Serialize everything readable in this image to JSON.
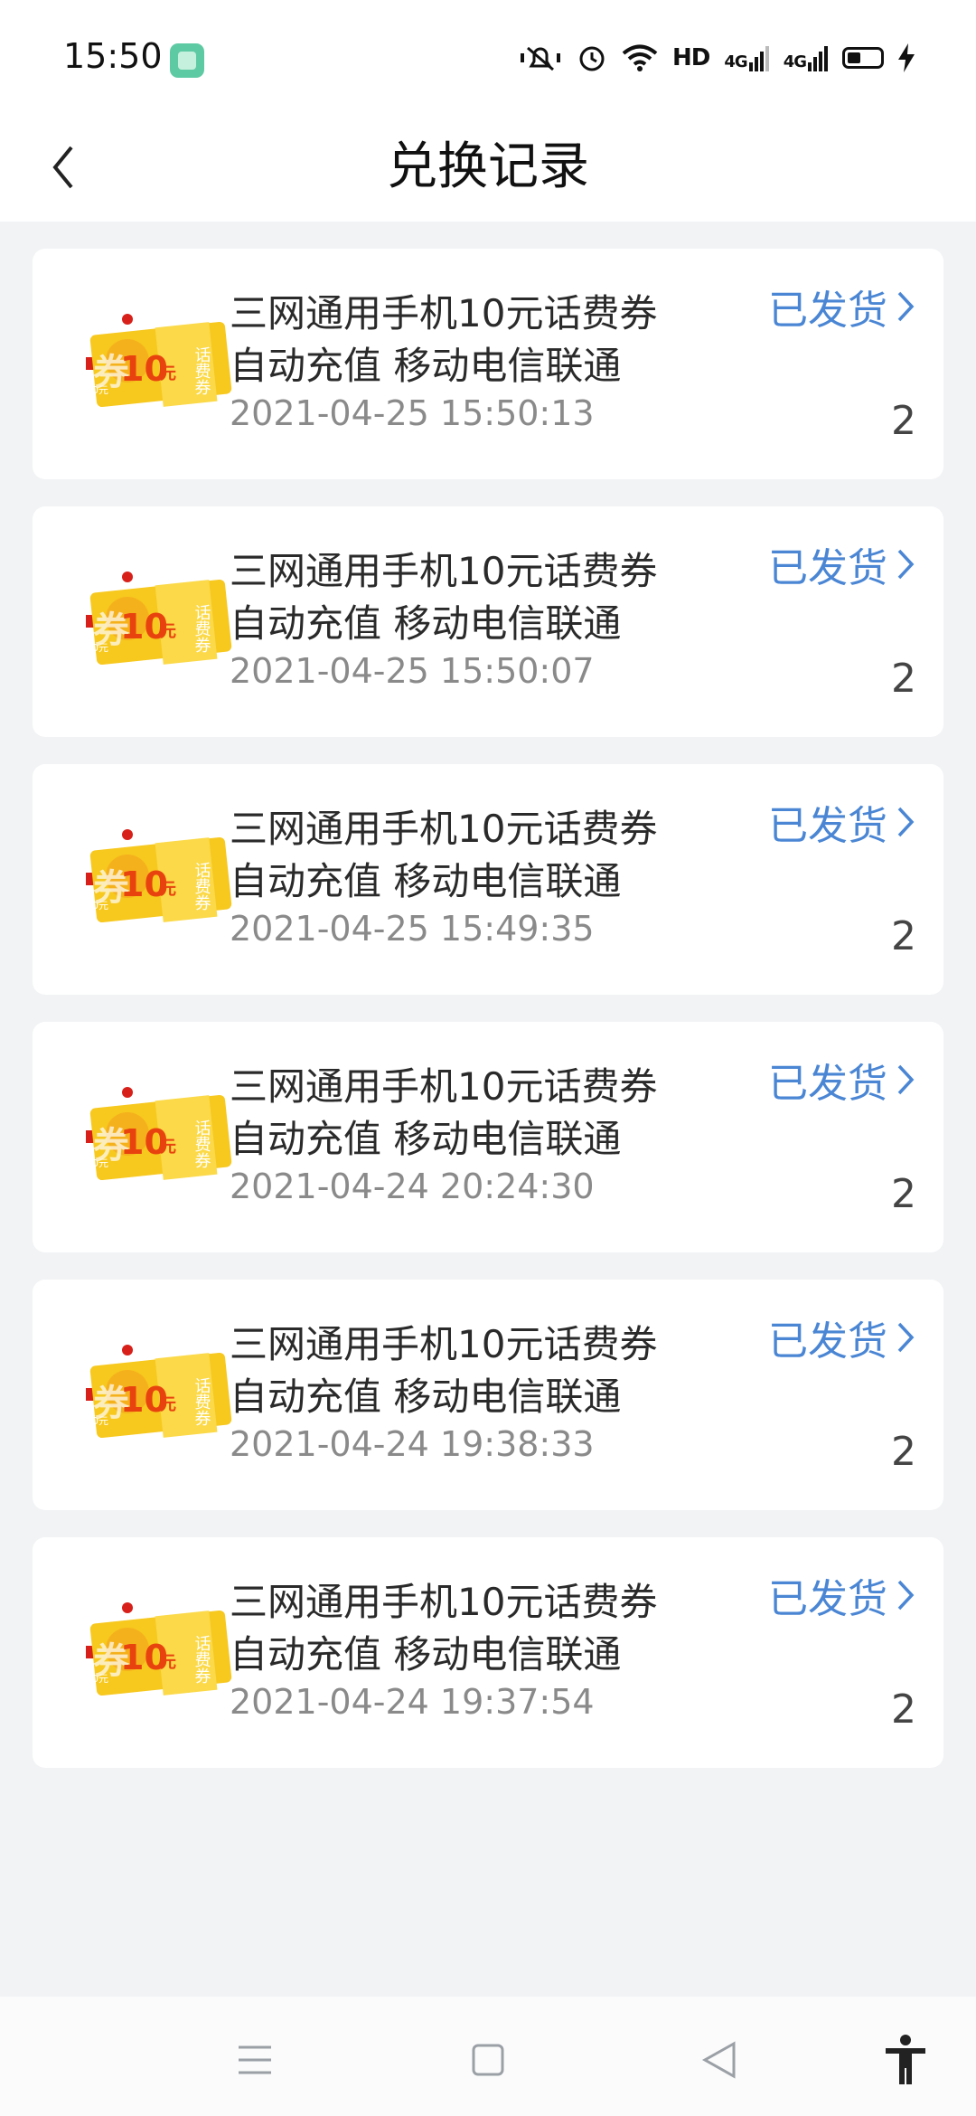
{
  "status_bar": {
    "time": "15:50",
    "hd_label": "HD",
    "signal1_label": "4G",
    "signal2_label": "4G",
    "icons": [
      "app-icon",
      "mute-icon",
      "alarm-icon",
      "wifi-icon",
      "signal-icon",
      "signal-icon",
      "battery-icon",
      "charging-icon"
    ]
  },
  "header": {
    "title": "兑换记录",
    "back_icon": "chevron-left-icon"
  },
  "records": [
    {
      "title_line1": "三网通用手机10元话费券",
      "title_line2": "自动充值 移动电信联通",
      "date": "2021-04-25 15:50:13",
      "status": "已发货",
      "quantity": "2"
    },
    {
      "title_line1": "三网通用手机10元话费券",
      "title_line2": "自动充值 移动电信联通",
      "date": "2021-04-25 15:50:07",
      "status": "已发货",
      "quantity": "2"
    },
    {
      "title_line1": "三网通用手机10元话费券",
      "title_line2": "自动充值 移动电信联通",
      "date": "2021-04-25 15:49:35",
      "status": "已发货",
      "quantity": "2"
    },
    {
      "title_line1": "三网通用手机10元话费券",
      "title_line2": "自动充值 移动电信联通",
      "date": "2021-04-24 20:24:30",
      "status": "已发货",
      "quantity": "2"
    },
    {
      "title_line1": "三网通用手机10元话费券",
      "title_line2": "自动充值 移动电信联通",
      "date": "2021-04-24 19:38:33",
      "status": "已发货",
      "quantity": "2"
    },
    {
      "title_line1": "三网通用手机10元话费券",
      "title_line2": "自动充值 移动电信联通",
      "date": "2021-04-24 19:37:54",
      "status": "已发货",
      "quantity": "2"
    }
  ],
  "coupon_image": {
    "amount": "10",
    "unit": "元",
    "side_text": "话费券",
    "big_char": "券",
    "small_tag": "10元"
  },
  "nav_bar": {
    "icons": [
      "menu-icon",
      "home-square-icon",
      "back-triangle-icon",
      "accessibility-icon"
    ]
  },
  "colors": {
    "accent_blue": "#4a86d4",
    "coupon_yellow": "#f7c81e",
    "coupon_orange": "#f39a1a",
    "background": "#f2f3f5"
  }
}
